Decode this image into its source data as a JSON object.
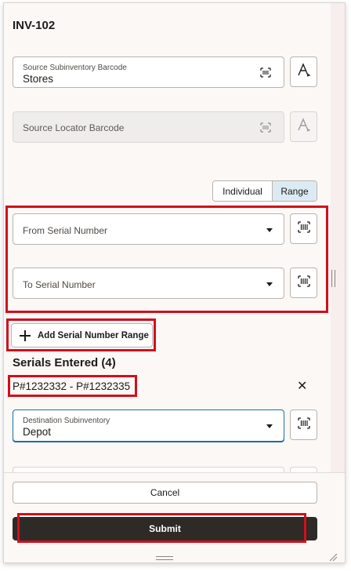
{
  "header": {
    "title": "INV-102"
  },
  "source_subinventory": {
    "label": "Source Subinventory Barcode",
    "value": "Stores"
  },
  "source_locator": {
    "placeholder": "Source Locator Barcode"
  },
  "mode_toggle": {
    "options": [
      "Individual",
      "Range"
    ],
    "selected": "Range"
  },
  "from_serial": {
    "placeholder": "From Serial Number"
  },
  "to_serial": {
    "placeholder": "To Serial Number"
  },
  "add_range": {
    "label": "Add Serial Number Range"
  },
  "serials": {
    "heading": "Serials Entered (4)",
    "range": "P#1232332 - P#1232335"
  },
  "destination": {
    "label": "Destination Subinventory",
    "value": "Depot"
  },
  "actions": {
    "cancel": "Cancel",
    "submit": "Submit"
  },
  "colors": {
    "highlight": "#d10f1c",
    "selected_segment": "#dcebf3",
    "submit_bg": "#2e2a26",
    "focus_border": "#1a6fa0"
  },
  "icons": [
    "barcode-scan-icon",
    "text-input-icon",
    "dropdown-caret-icon",
    "plus-icon",
    "close-icon"
  ]
}
